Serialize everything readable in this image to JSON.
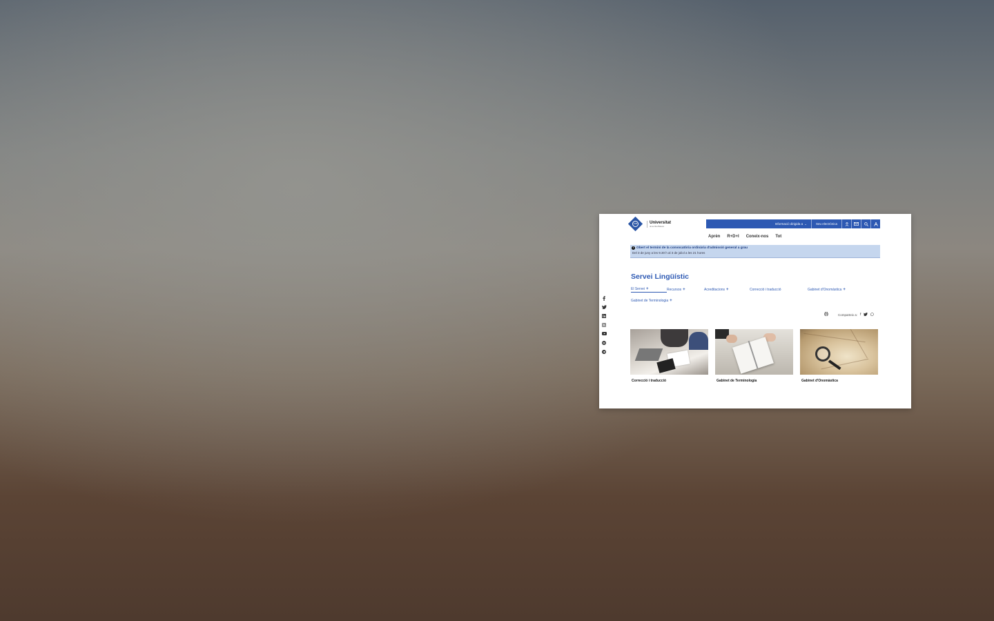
{
  "site": {
    "logo_title": "Universitat",
    "logo_subtitle": "de les Illes Balears",
    "logo_mark": "UIB"
  },
  "topbar": {
    "info_label": "Informació dirigida a",
    "seu_label": "Seu electrònica",
    "icons": [
      "user-icon",
      "mail-icon",
      "search-icon",
      "accessibility-icon"
    ]
  },
  "mainnav": {
    "items": [
      {
        "label": "Aprèn"
      },
      {
        "label": "R+D+I"
      },
      {
        "label": "Coneix-nos"
      },
      {
        "label": "Tot"
      }
    ]
  },
  "notice": {
    "title": "Obert el termini de la convocatòria ordinària d'admissió general a grau",
    "subtitle": "Del 3 de juny a les 9.30 h al 3 de juliol a les 21 hores"
  },
  "page": {
    "title": "Servei Lingüístic"
  },
  "subnav": {
    "items": [
      {
        "label": "El Servei",
        "plus": "+"
      },
      {
        "label": "Recursos",
        "plus": "+"
      },
      {
        "label": "Acreditacions",
        "plus": "+"
      },
      {
        "label": "Correcció i traducció",
        "plus": ""
      },
      {
        "label": "Gabinet d'Onomàstica",
        "plus": "+"
      },
      {
        "label": "Gabinet de Terminologia",
        "plus": "+"
      }
    ]
  },
  "share": {
    "label": "Comparteix a:"
  },
  "cards": [
    {
      "label": "Correcció i traducció"
    },
    {
      "label": "Gabinet de Terminologia"
    },
    {
      "label": "Gabinet d'Onomàstica"
    }
  ],
  "colors": {
    "brand_blue": "#2d59b3",
    "notice_bg": "#c5d6ee"
  }
}
